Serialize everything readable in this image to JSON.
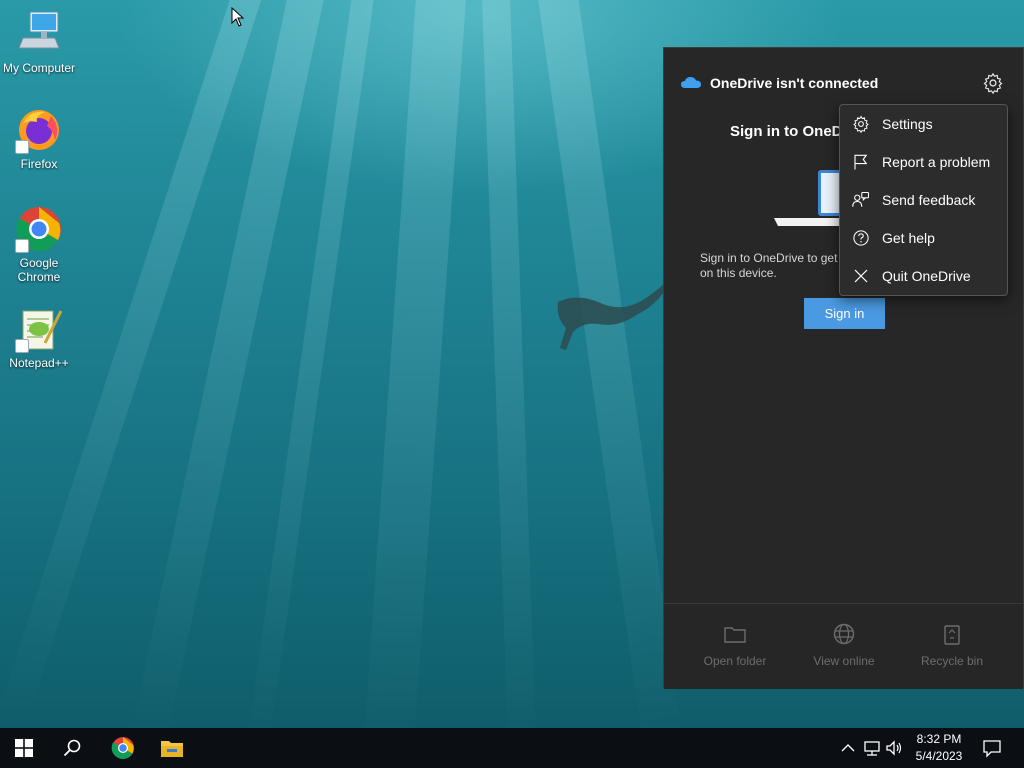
{
  "desktop": {
    "icons": [
      {
        "label": "My Computer",
        "icon": "computer-icon"
      },
      {
        "label": "Firefox",
        "icon": "firefox-icon"
      },
      {
        "label": "Google\nChrome",
        "icon": "chrome-icon"
      },
      {
        "label": "Notepad++",
        "icon": "notepadpp-icon"
      }
    ]
  },
  "onedrive": {
    "title": "OneDrive isn't connected",
    "signin_title": "Sign in to OneD",
    "description": "Sign in to OneDrive to get on this device.",
    "signin_button": "Sign in",
    "footer": [
      {
        "label": "Open folder",
        "icon": "folder-icon"
      },
      {
        "label": "View online",
        "icon": "globe-icon"
      },
      {
        "label": "Recycle bin",
        "icon": "recycle-bin-icon"
      }
    ],
    "accent_color": "#4a9ae3"
  },
  "menu": {
    "items": [
      {
        "label": "Settings",
        "icon": "gear-icon"
      },
      {
        "label": "Report a problem",
        "icon": "flag-icon"
      },
      {
        "label": "Send feedback",
        "icon": "feedback-icon"
      },
      {
        "label": "Get help",
        "icon": "help-icon"
      },
      {
        "label": "Quit OneDrive",
        "icon": "close-icon"
      }
    ]
  },
  "taskbar": {
    "time": "8:32 PM",
    "date": "5/4/2023"
  }
}
